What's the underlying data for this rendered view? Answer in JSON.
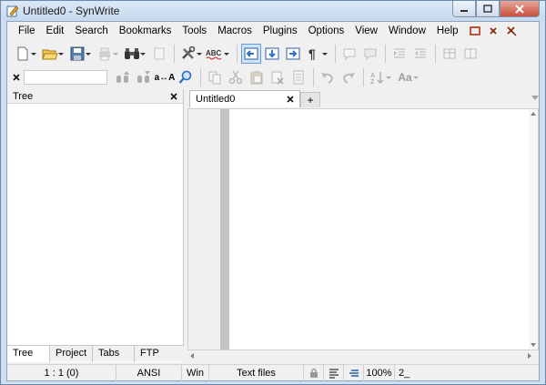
{
  "window": {
    "title": "Untitled0 - SynWrite"
  },
  "menu": {
    "items": [
      "File",
      "Edit",
      "Search",
      "Bookmarks",
      "Tools",
      "Macros",
      "Plugins",
      "Options",
      "View",
      "Window",
      "Help"
    ],
    "extra_icons": [
      "restore-window-icon",
      "close-doc-icon",
      "close-all-docs-icon"
    ]
  },
  "toolbar1": {
    "buttons": [
      "new-file",
      "open-file",
      "save-file",
      "print",
      "find",
      "page-setup",
      "tools",
      "spell-check",
      "move-prev",
      "move-down",
      "move-next",
      "paragraph-marks",
      "comment-add",
      "comment-remove",
      "indent",
      "unindent",
      "table-view",
      "split-view"
    ]
  },
  "toolbar2": {
    "search_placeholder": "",
    "buttons": [
      "find-prev",
      "find-next",
      "match-case",
      "find-in-files",
      "copy",
      "cut",
      "paste",
      "delete",
      "paste-special",
      "undo",
      "redo",
      "sort",
      "change-case"
    ],
    "match_case_label": "a↔A",
    "change_case_label": "Aa"
  },
  "left_panel": {
    "title": "Tree",
    "tabs": [
      "Tree",
      "Project",
      "Tabs",
      "FTP"
    ],
    "active_tab": 0
  },
  "editor": {
    "tabs": [
      {
        "label": "Untitled0"
      }
    ],
    "add_tab_label": "+"
  },
  "statusbar": {
    "position": "1 : 1 (0)",
    "encoding": "ANSI",
    "line_ending": "Win",
    "lexer": "Text files",
    "zoom": "100%",
    "insert_mode": "2_"
  },
  "colors": {
    "titlebar": "#c6d9ee",
    "client_bg": "#f0f0f0",
    "gutter": "#c4c4c4",
    "active_button": "#cde3f8",
    "close_button": "#c8503c"
  }
}
